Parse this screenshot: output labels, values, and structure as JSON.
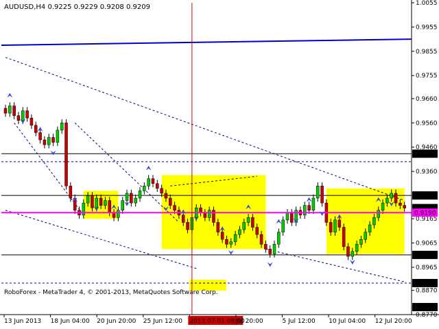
{
  "colors": {
    "background": "#ffffff",
    "bull_candle": "#00cc00",
    "bear_candle": "#cc0000",
    "channel_line": "#0000cc",
    "pivot_line": "#ff00ff",
    "zone_fill": "#ffff00",
    "marker": "#3a4bd8",
    "cursor_line": "#cc0000",
    "price_tag": "#000000",
    "level_tag_text": "#ffffff",
    "dashed_line": "#000088"
  },
  "chart_data": {
    "type": "candlestick",
    "symbol_header": "AUDUSD,H4  0.9225 0.9229 0.9208 0.9209",
    "footer": "RoboForex - MetaTrader 4, © 2001-2013, MetaQuotes Software Corp.",
    "ylim": [
      0.877,
      1.0055
    ],
    "y_ticks": [
      "1.0055",
      "0.9955",
      "0.9855",
      "0.9755",
      "0.9660",
      "0.9560",
      "0.9460",
      "0.9360",
      "0.9165",
      "0.9065",
      "0.8965",
      "0.8870",
      "0.8770"
    ],
    "x_ticks": [
      "13 Jun 2013",
      "18 Jun 04:00",
      "20 Jun 20:00",
      "25 Jun 12:00",
      "2013.07.01 08:00",
      "Jul 20:00",
      "5 Jul 12:00",
      "10 Jul 04:00",
      "12 Jul 20:00"
    ],
    "cursor_date": "2013.07.01 08:00",
    "level_tags": [
      {
        "value": 0.9433,
        "label": "0.9433",
        "style": "dark"
      },
      {
        "value": 0.9261,
        "label": "0.9261",
        "style": "dark"
      },
      {
        "value": 0.9209,
        "label": "0.9209",
        "style": "dark"
      },
      {
        "value": 0.919,
        "label": "0.9190",
        "style": "pivot"
      },
      {
        "value": 0.9016,
        "label": "0.9016",
        "style": "dark"
      },
      {
        "value": 0.89,
        "label": "0.8900",
        "style": "dark"
      },
      {
        "value": 0.8801,
        "label": "0.8801",
        "style": "dark"
      }
    ],
    "horizontal_levels": [
      {
        "value": 0.9433,
        "style": "solid"
      },
      {
        "value": 0.9261,
        "style": "solid"
      },
      {
        "value": 0.9016,
        "style": "solid"
      },
      {
        "value": 0.89,
        "style": "dashed"
      },
      {
        "value": 0.94,
        "style": "dashed"
      }
    ],
    "pivot_level": 0.919,
    "close": [
      0.96,
      0.963,
      0.959,
      0.957,
      0.961,
      0.958,
      0.955,
      0.952,
      0.949,
      0.947,
      0.95,
      0.948,
      0.953,
      0.956,
      0.93,
      0.925,
      0.92,
      0.918,
      0.923,
      0.926,
      0.921,
      0.925,
      0.922,
      0.924,
      0.919,
      0.917,
      0.92,
      0.924,
      0.927,
      0.923,
      0.925,
      0.928,
      0.93,
      0.933,
      0.931,
      0.929,
      0.927,
      0.925,
      0.922,
      0.92,
      0.918,
      0.915,
      0.912,
      0.917,
      0.921,
      0.919,
      0.917,
      0.92,
      0.915,
      0.911,
      0.908,
      0.906,
      0.907,
      0.91,
      0.912,
      0.915,
      0.917,
      0.913,
      0.91,
      0.906,
      0.904,
      0.902,
      0.906,
      0.911,
      0.916,
      0.919,
      0.915,
      0.92,
      0.918,
      0.922,
      0.92,
      0.925,
      0.93,
      0.923,
      0.915,
      0.911,
      0.916,
      0.913,
      0.905,
      0.901,
      0.903,
      0.906,
      0.908,
      0.911,
      0.914,
      0.917,
      0.92,
      0.923,
      0.925,
      0.927,
      0.923,
      0.922,
      0.9209
    ]
  }
}
